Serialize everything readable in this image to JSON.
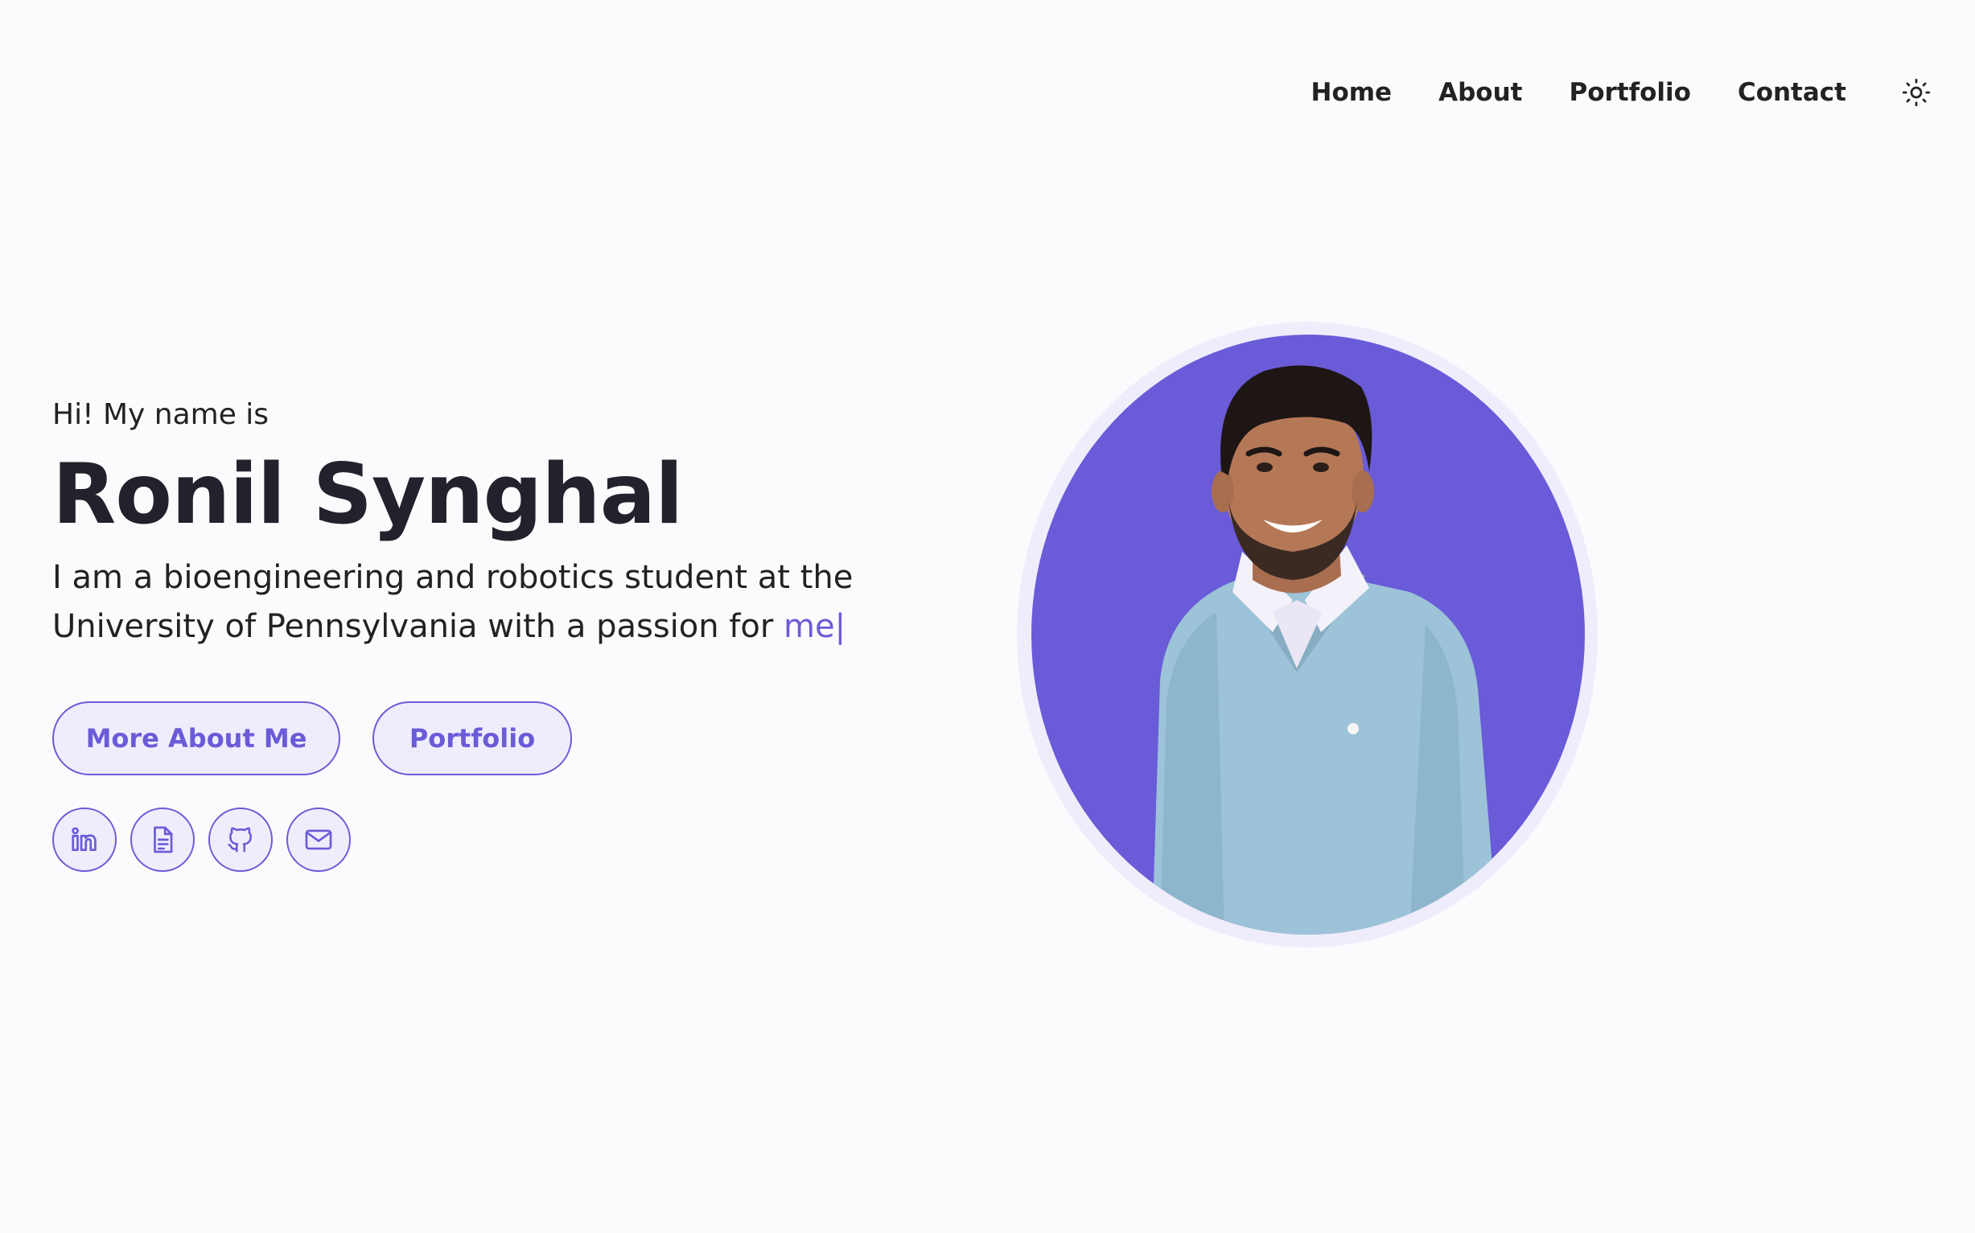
{
  "nav": {
    "links": [
      "Home",
      "About",
      "Portfolio",
      "Contact"
    ],
    "theme_icon": "sun-icon"
  },
  "hero": {
    "greeting": "Hi! My name is",
    "name": "Ronil Synghal",
    "tagline": "I am a bioengineering and robotics student at the University of Pennsylvania with a passion for ",
    "typed_word": "me",
    "caret": "|",
    "buttons": {
      "more_about": "More About Me",
      "portfolio": "Portfolio"
    },
    "socials": [
      {
        "icon": "linkedin-icon"
      },
      {
        "icon": "document-icon"
      },
      {
        "icon": "github-icon"
      },
      {
        "icon": "mail-icon"
      }
    ]
  },
  "colors": {
    "accent": "#6a5bd8",
    "accent_light": "#efedfb",
    "background": "#fbfbfd",
    "text": "#22222c"
  }
}
